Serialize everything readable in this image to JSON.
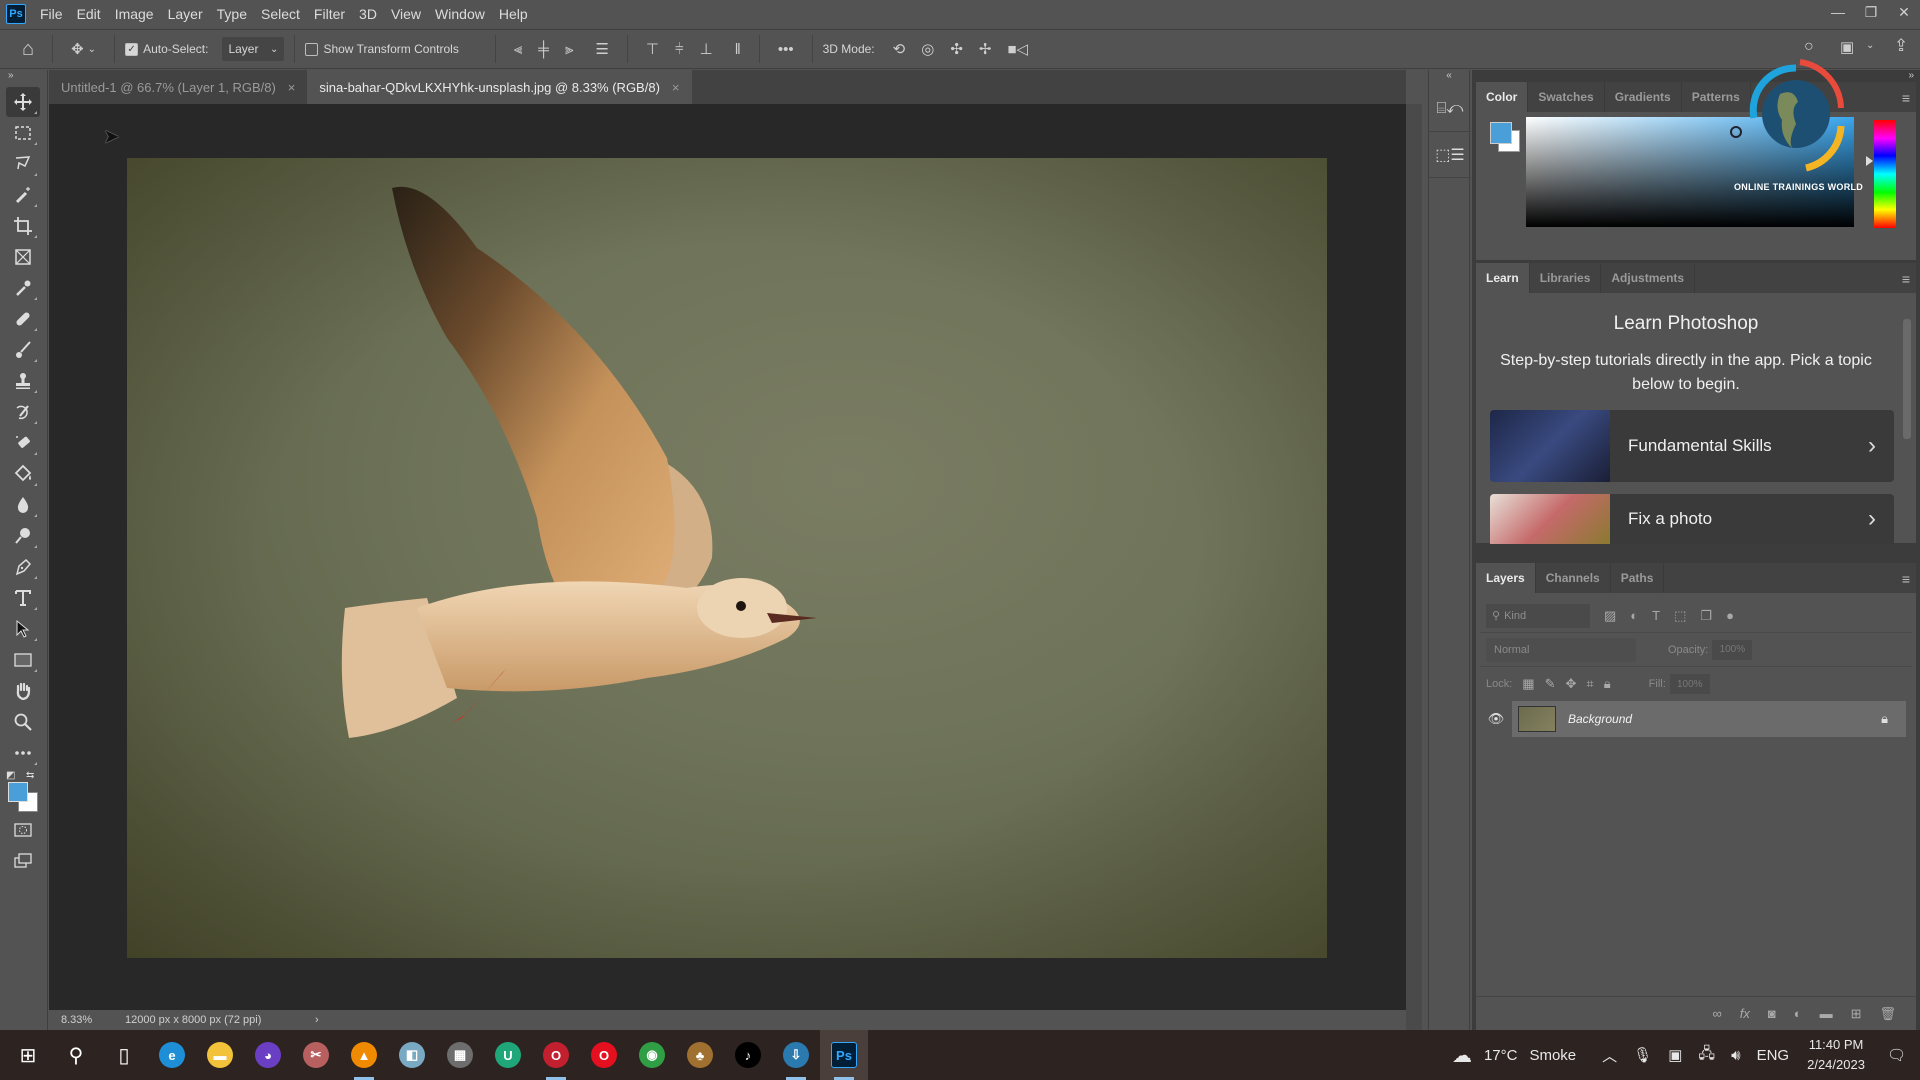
{
  "app": {
    "name": "Photoshop",
    "logo_text": "Ps"
  },
  "menu": [
    "File",
    "Edit",
    "Image",
    "Layer",
    "Type",
    "Select",
    "Filter",
    "3D",
    "View",
    "Window",
    "Help"
  ],
  "window_controls": {
    "minimize": "—",
    "restore": "❐",
    "close": "✕"
  },
  "options_bar": {
    "auto_select_label": "Auto-Select:",
    "auto_select_checked": true,
    "layer_select_value": "Layer",
    "show_transform_label": "Show Transform Controls",
    "show_transform_checked": false,
    "more_label": "•••",
    "mode_3d_label": "3D Mode:"
  },
  "doc_tabs": [
    {
      "label": "Untitled-1 @ 66.7% (Layer 1, RGB/8)",
      "active": false
    },
    {
      "label": "sina-bahar-QDkvLKXHYhk-unsplash.jpg @ 8.33% (RGB/8)",
      "active": true
    }
  ],
  "status": {
    "zoom": "8.33%",
    "doc_size": "12000 px x 8000 px (72 ppi)",
    "arrow": "›"
  },
  "toolbar": {
    "tools": [
      "move-tool",
      "rectangular-marquee-tool",
      "lasso-tool",
      "magic-wand-tool",
      "crop-tool",
      "frame-tool",
      "eyedropper-tool",
      "healing-brush-tool",
      "brush-tool",
      "clone-stamp-tool",
      "history-brush-tool",
      "eraser-tool",
      "paint-bucket-tool",
      "blur-tool",
      "dodge-tool",
      "pen-tool",
      "type-tool",
      "path-selection-tool",
      "rectangle-tool",
      "hand-tool",
      "zoom-tool",
      "edit-toolbar"
    ],
    "foreground_color": "#4a9fd8",
    "background_color": "#ffffff"
  },
  "color_panel": {
    "tabs": [
      "Color",
      "Swatches",
      "Gradients",
      "Patterns"
    ],
    "active_tab": "Color",
    "foreground_color": "#4a9fd8",
    "background_color": "#ffffff"
  },
  "watermark": {
    "text": "ONLINE TRAININGS WORLD"
  },
  "learn_panel": {
    "tabs": [
      "Learn",
      "Libraries",
      "Adjustments"
    ],
    "active_tab": "Learn",
    "title": "Learn Photoshop",
    "description": "Step-by-step tutorials directly in the app. Pick a topic below to begin.",
    "cards": [
      {
        "label": "Fundamental Skills",
        "chevron": "›"
      },
      {
        "label": "Fix a photo",
        "chevron": "›"
      }
    ]
  },
  "layers_panel": {
    "tabs": [
      "Layers",
      "Channels",
      "Paths"
    ],
    "active_tab": "Layers",
    "kind_placeholder": "Kind",
    "blend_mode": "Normal",
    "opacity_label": "Opacity:",
    "opacity_value": "100%",
    "lock_label": "Lock:",
    "fill_label": "Fill:",
    "fill_value": "100%",
    "layers": [
      {
        "name": "Background",
        "visible": true,
        "locked": true
      }
    ]
  },
  "taskbar": {
    "apps": [
      {
        "name": "start",
        "glyph": "⊞",
        "color": "#ffffff"
      },
      {
        "name": "search",
        "glyph": "⚲",
        "color": "#ffffff"
      },
      {
        "name": "task-view",
        "glyph": "▯",
        "color": "#ffffff"
      },
      {
        "name": "edge",
        "glyph": "e",
        "color": "#1e8fd6"
      },
      {
        "name": "file-explorer",
        "glyph": "▬",
        "color": "#f2c23a"
      },
      {
        "name": "app-owl",
        "glyph": "◕",
        "color": "#6b3fc4"
      },
      {
        "name": "app-snip",
        "glyph": "✂",
        "color": "#b86060"
      },
      {
        "name": "vlc",
        "glyph": "▲",
        "color": "#f08a00"
      },
      {
        "name": "app-notes",
        "glyph": "◧",
        "color": "#7aa9c4"
      },
      {
        "name": "media-player",
        "glyph": "▦",
        "color": "#6d6d6d"
      },
      {
        "name": "app-u",
        "glyph": "U",
        "color": "#1fa77a"
      },
      {
        "name": "opera-gx",
        "glyph": "O",
        "color": "#c2202f"
      },
      {
        "name": "opera",
        "glyph": "O",
        "color": "#e41020"
      },
      {
        "name": "chrome",
        "glyph": "◉",
        "color": "#2f9e44"
      },
      {
        "name": "app-cocktail",
        "glyph": "♣",
        "color": "#a07030"
      },
      {
        "name": "tiktok",
        "glyph": "♪",
        "color": "#000000"
      },
      {
        "name": "app-download",
        "glyph": "⇩",
        "color": "#2a7ab0"
      },
      {
        "name": "photoshop",
        "glyph": "Ps",
        "color": "#001e36"
      }
    ],
    "weather_temp": "17°C",
    "weather_desc": "Smoke",
    "language": "ENG",
    "time": "11:40 PM",
    "date": "2/24/2023"
  }
}
